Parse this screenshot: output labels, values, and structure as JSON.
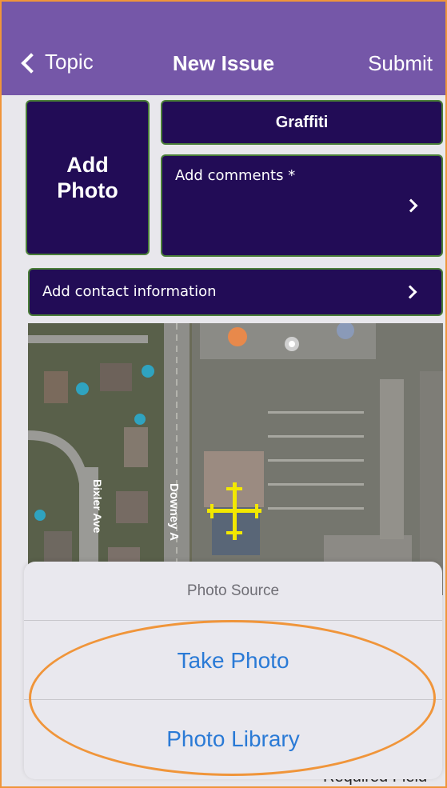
{
  "nav": {
    "back_label": "Topic",
    "title": "New Issue",
    "submit_label": "Submit"
  },
  "form": {
    "add_photo_line1": "Add",
    "add_photo_line2": "Photo",
    "category": "Graffiti",
    "comments_placeholder": "Add comments *",
    "contact_label": "Add contact information"
  },
  "map": {
    "street_labels": [
      "Bixler Ave",
      "Downey A"
    ]
  },
  "sheet": {
    "title": "Photo Source",
    "options": [
      "Take Photo",
      "Photo Library"
    ]
  },
  "footer": {
    "required_note": "Required Field"
  },
  "colors": {
    "nav_bar": "#7557a8",
    "panel": "#220c56",
    "action_blue": "#2a7ad6",
    "highlight": "#f0953a",
    "pin": "#f2e800"
  },
  "icons": [
    "chevron-left-icon",
    "chevron-right-icon",
    "location-pin-icon"
  ]
}
